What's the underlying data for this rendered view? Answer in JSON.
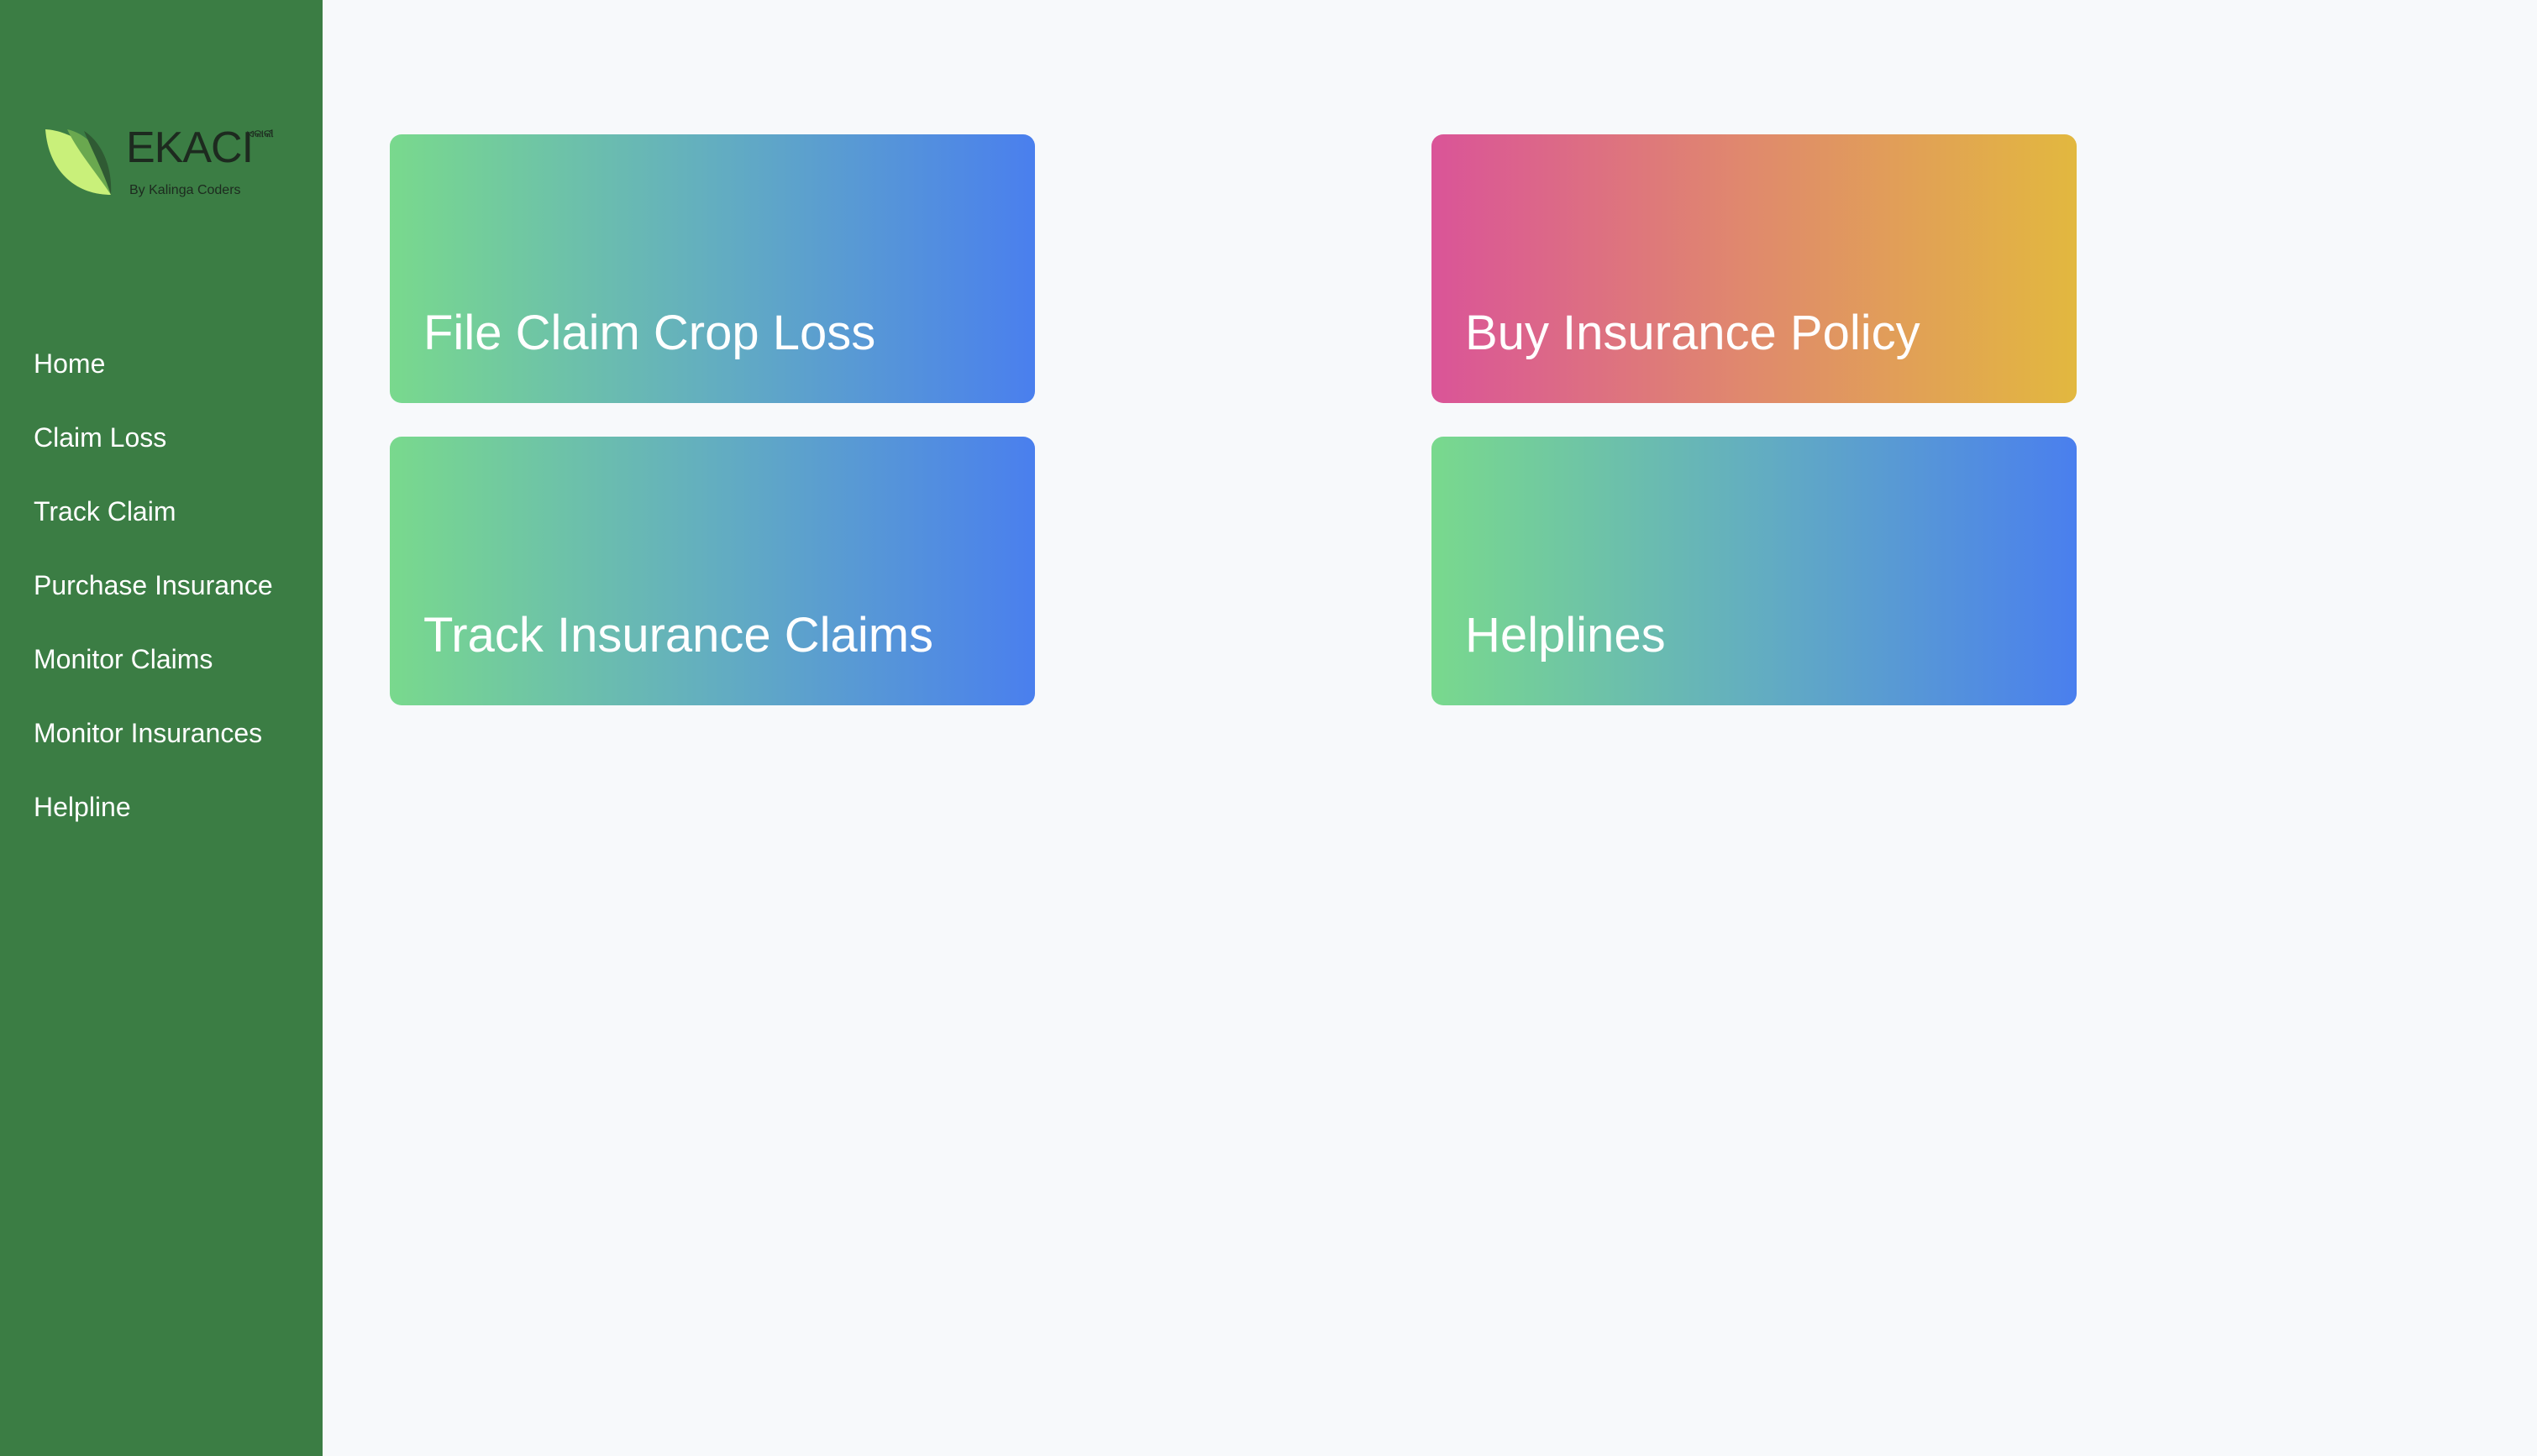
{
  "logo": {
    "wordmark": "EKACI",
    "script_text": "ଏକାକୀ",
    "tagline": "By Kalinga Coders",
    "leaf_colors": [
      "#c9f07a",
      "#6aa84f",
      "#2f5a33"
    ]
  },
  "sidebar": {
    "background": "#3b7d44",
    "items": [
      {
        "label": "Home"
      },
      {
        "label": "Claim Loss"
      },
      {
        "label": "Track Claim"
      },
      {
        "label": "Purchase Insurance"
      },
      {
        "label": "Monitor Claims"
      },
      {
        "label": "Monitor Insurances"
      },
      {
        "label": "Helpline"
      }
    ]
  },
  "cards": [
    {
      "label": "File Claim Crop Loss",
      "gradient": [
        "#79d98d",
        "#4a7fee"
      ]
    },
    {
      "label": "Buy Insurance Policy",
      "gradient": [
        "#da5498",
        "#e2b83f"
      ]
    },
    {
      "label": "Track Insurance Claims",
      "gradient": [
        "#79d98d",
        "#4a7fee"
      ]
    },
    {
      "label": "Helplines",
      "gradient": [
        "#79d98d",
        "#4a7fee"
      ]
    }
  ]
}
